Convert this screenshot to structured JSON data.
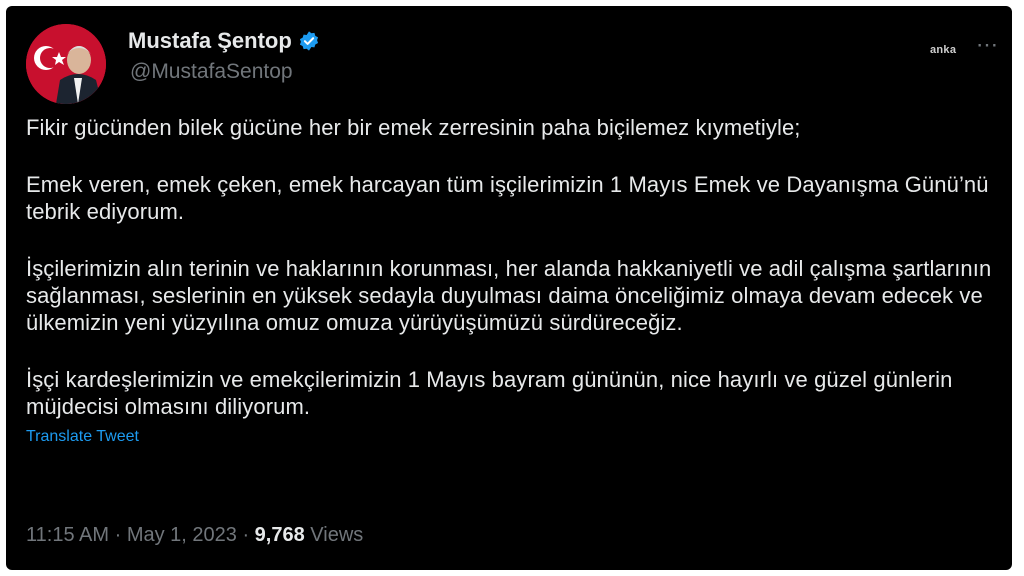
{
  "user": {
    "display_name": "Mustafa Şentop",
    "handle": "@MustafaSentop",
    "verified_icon": "verified-badge-icon",
    "avatar_icon": "profile-avatar"
  },
  "watermark": "anka",
  "more_icon": "more-options-icon",
  "tweet": {
    "paragraphs": [
      "Fikir gücünden bilek gücüne her bir emek zerresinin paha biçilemez kıymetiyle;",
      "Emek veren, emek çeken, emek harcayan tüm işçilerimizin 1 Mayıs Emek ve Dayanışma Günü’nü tebrik ediyorum.",
      "İşçilerimizin alın terinin ve haklarının korunması, her alanda hakkaniyetli ve adil çalışma şartlarının sağlanması, seslerinin en yüksek sedayla duyulması daima önceliğimiz olmaya devam edecek ve ülkemizin yeni yüzyılına omuz omuza yürüyüşümüzü sürdüreceğiz.",
      "İşçi kardeşlerimizin ve emekçilerimizin 1 Mayıs bayram gününün, nice hayırlı ve güzel günlerin müjdecisi olmasını diliyorum."
    ],
    "translate_label": "Translate Tweet"
  },
  "meta": {
    "time": "11:15 AM",
    "separator": " · ",
    "date": "May 1, 2023",
    "views_count": "9,768",
    "views_label": " Views"
  },
  "colors": {
    "background": "#000000",
    "text": "#e7e9ea",
    "muted": "#71767b",
    "link": "#1d9bf0",
    "verified": "#1d9bf0"
  }
}
